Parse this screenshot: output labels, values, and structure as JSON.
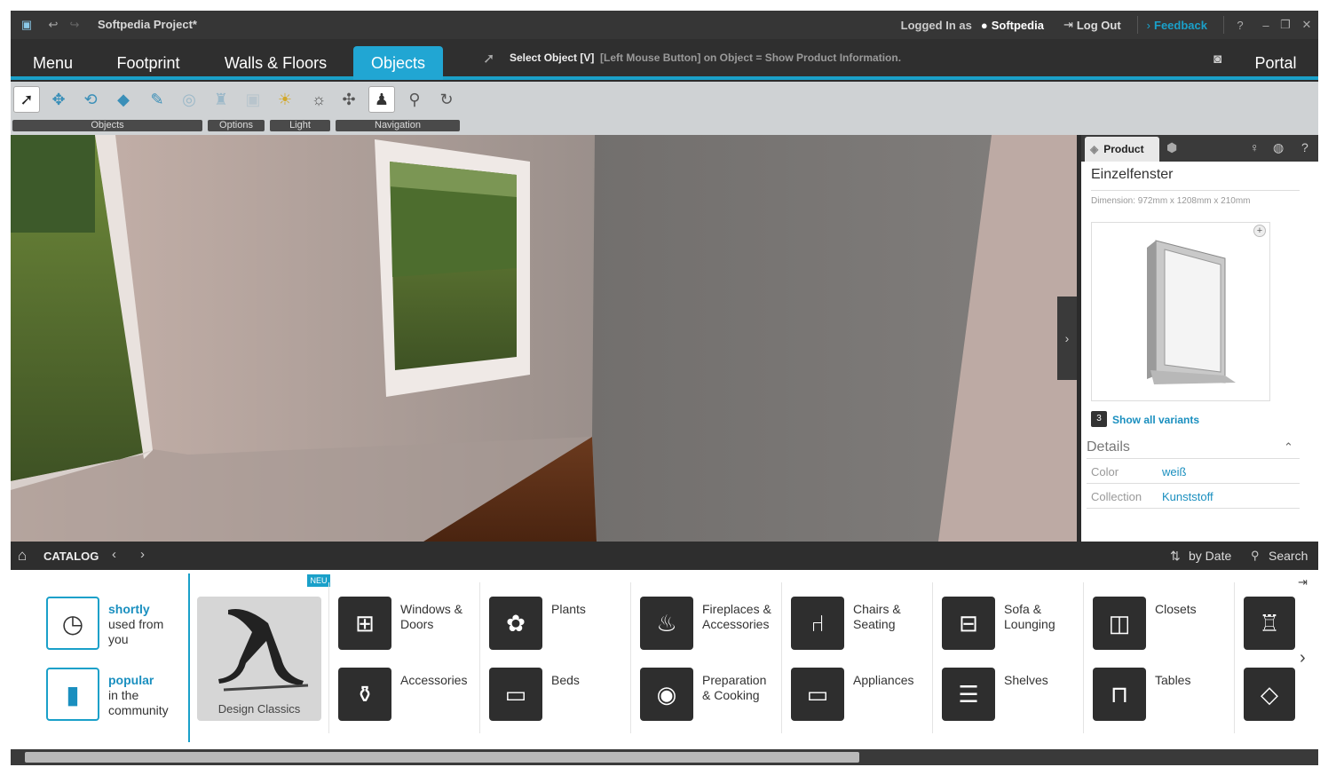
{
  "titlebar": {
    "title": "Softpedia Project*",
    "logged_in_label": "Logged In as",
    "user": "Softpedia",
    "logout": "Log Out",
    "feedback": "Feedback",
    "help": "?"
  },
  "menu": {
    "tabs": [
      {
        "label": "Menu"
      },
      {
        "label": "Footprint"
      },
      {
        "label": "Walls & Floors"
      },
      {
        "label": "Objects"
      }
    ],
    "hint_bold": "Select Object [V]",
    "hint_rest": "[Left Mouse Button] on Object = Show Product Information.",
    "portal": "Portal"
  },
  "toolbar": {
    "groups": {
      "objects": "Objects",
      "options": "Options",
      "light": "Light",
      "navigation": "Navigation"
    }
  },
  "product": {
    "tab": "Product",
    "name": "Einzelfenster",
    "dimension": "Dimension: 972mm x 1208mm x 210mm",
    "variants_count": "3",
    "variants_label": "Show all variants",
    "details_title": "Details",
    "details": [
      {
        "key": "Color",
        "value": "weiß"
      },
      {
        "key": "Collection",
        "value": "Kunststoff"
      }
    ]
  },
  "catalog": {
    "title": "CATALOG",
    "sort": "by Date",
    "search": "Search",
    "shortly_1": "shortly",
    "shortly_2": "used from",
    "shortly_3": "you",
    "popular_1": "popular",
    "popular_2": "in the",
    "popular_3": "community",
    "neu": "NEU",
    "design_classics": "Design Classics",
    "items": {
      "windows": [
        "Windows &",
        "Doors"
      ],
      "plants": [
        "Plants"
      ],
      "fireplaces": [
        "Fireplaces &",
        "Accessories"
      ],
      "chairs": [
        "Chairs &",
        "Seating"
      ],
      "sofa": [
        "Sofa &",
        "Lounging"
      ],
      "closets": [
        "Closets"
      ],
      "accessories": [
        "Accessories"
      ],
      "beds": [
        "Beds"
      ],
      "cooking": [
        "Preparation",
        "& Cooking"
      ],
      "appliances": [
        "Appliances"
      ],
      "shelves": [
        "Shelves"
      ],
      "tables": [
        "Tables"
      ]
    }
  },
  "colors": {
    "accent": "#21a6d3",
    "link": "#1a8fbf",
    "dark": "#2b2b2b"
  }
}
